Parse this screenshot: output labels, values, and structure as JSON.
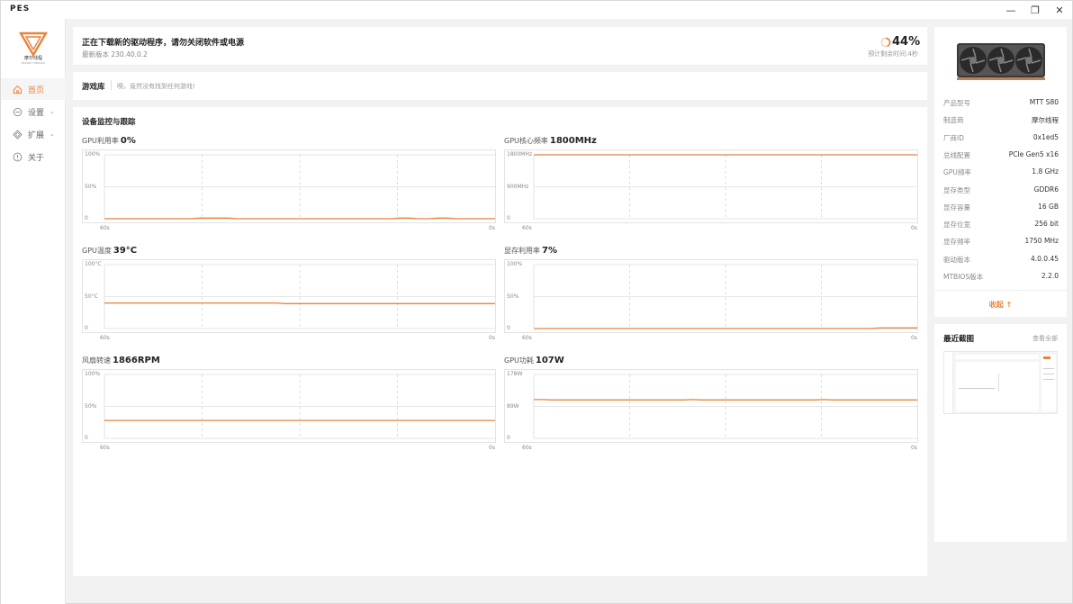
{
  "app": {
    "title": "PES"
  },
  "window_controls": {
    "minimize": "—",
    "restore": "❐",
    "close": "✕"
  },
  "brand": {
    "name": "摩尔线程",
    "sub": "MOORE THREADS"
  },
  "sidebar": {
    "items": [
      {
        "label": "首页",
        "icon": "home-icon",
        "active": true
      },
      {
        "label": "设置",
        "icon": "settings-icon",
        "chevron": "⌄"
      },
      {
        "label": "扩展",
        "icon": "extension-icon",
        "chevron": "⌄"
      },
      {
        "label": "关于",
        "icon": "info-icon"
      }
    ]
  },
  "download": {
    "title": "正在下载新的驱动程序，请勿关闭软件或电源",
    "version": "最新版本 230.40.0.2",
    "percent": "44%",
    "progress": 0.44,
    "remaining": "预计剩余时间:4秒",
    "accent": "#e8833a"
  },
  "library": {
    "title": "游戏库",
    "empty": "噢，竟然没有找到任何游戏!"
  },
  "monitor": {
    "title": "设备监控与跟踪",
    "charts": [
      {
        "label": "GPU利用率",
        "value": "0%",
        "yticks": [
          "100%",
          "50%",
          "0"
        ],
        "ymax": 100,
        "x_start": "60s",
        "x_end": "0s",
        "series": [
          0,
          0,
          0,
          0,
          0,
          0,
          0,
          0,
          0,
          0,
          1,
          1,
          1,
          1,
          0,
          0,
          0,
          0,
          0,
          0,
          0,
          0,
          0,
          0,
          0,
          0,
          0,
          0,
          0,
          0,
          0,
          1,
          1,
          0,
          0,
          1,
          1,
          0,
          0,
          0,
          0,
          0
        ]
      },
      {
        "label": "GPU核心频率",
        "value": "1800MHz",
        "yticks": [
          "1800MHz",
          "900MHz",
          "0"
        ],
        "ymax": 1800,
        "x_start": "60s",
        "x_end": "0s",
        "series": [
          1800,
          1800,
          1800,
          1800,
          1800,
          1800,
          1800,
          1800,
          1800,
          1800,
          1800,
          1800,
          1800,
          1800,
          1800,
          1800,
          1800,
          1800,
          1800,
          1800,
          1800,
          1800
        ]
      },
      {
        "label": "GPU温度",
        "value": "39°C",
        "yticks": [
          "100°C",
          "50°C",
          "0"
        ],
        "ymax": 100,
        "x_start": "60s",
        "x_end": "0s",
        "series": [
          40,
          40,
          40,
          40,
          40,
          40,
          40,
          40,
          40,
          40,
          40,
          40,
          40,
          40,
          40,
          40,
          40,
          40,
          40,
          39,
          39,
          39,
          39,
          39,
          39,
          39,
          39,
          39,
          39,
          39,
          39,
          39,
          39,
          39,
          39,
          39,
          39,
          39,
          39,
          39,
          39,
          39
        ]
      },
      {
        "label": "显存利用率",
        "value": "7%",
        "yticks": [
          "100%",
          "50%",
          "0"
        ],
        "ymax": 100,
        "x_start": "60s",
        "x_end": "0s",
        "series": [
          0,
          0,
          0,
          0,
          0,
          0,
          0,
          0,
          0,
          0,
          0,
          0,
          0,
          0,
          0,
          0,
          0,
          0,
          0,
          0,
          0,
          0,
          0,
          0,
          0,
          0,
          0,
          0,
          0,
          0,
          0,
          0,
          0,
          0,
          0,
          0,
          0,
          1,
          1,
          1,
          1,
          1
        ]
      },
      {
        "label": "风扇转速",
        "value": "1866RPM",
        "yticks": [
          "100%",
          "50%",
          "0"
        ],
        "ymax": 100,
        "x_start": "60s",
        "x_end": "0s",
        "series": [
          28,
          28,
          28,
          28,
          28,
          28,
          28,
          28,
          28,
          28,
          28,
          28,
          28,
          28,
          28,
          28,
          28,
          28,
          28,
          28,
          28,
          28,
          28,
          28,
          28,
          28,
          28,
          28,
          28,
          28,
          28,
          28,
          28,
          28,
          28,
          28,
          28,
          28,
          28,
          28,
          28,
          28
        ]
      },
      {
        "label": "GPU功耗",
        "value": "107W",
        "yticks": [
          "178W",
          "89W",
          "0"
        ],
        "ymax": 178,
        "x_start": "60s",
        "x_end": "0s",
        "series": [
          108,
          108,
          107,
          107,
          107,
          107,
          107,
          107,
          107,
          107,
          107,
          107,
          107,
          107,
          107,
          107,
          107,
          108,
          107,
          107,
          107,
          107,
          107,
          107,
          107,
          107,
          107,
          107,
          107,
          107,
          107,
          108,
          107,
          107,
          107,
          107,
          107,
          107,
          107,
          107,
          107,
          107
        ]
      }
    ]
  },
  "device": {
    "rows": [
      {
        "k": "产品型号",
        "v": "MTT S80"
      },
      {
        "k": "制造商",
        "v": "摩尔线程"
      },
      {
        "k": "厂商ID",
        "v": "0x1ed5"
      },
      {
        "k": "总线配置",
        "v": "PCIe Gen5 x16"
      },
      {
        "k": "GPU频率",
        "v": "1.8 GHz"
      },
      {
        "k": "显存类型",
        "v": "GDDR6"
      },
      {
        "k": "显存容量",
        "v": "16 GB"
      },
      {
        "k": "显存位宽",
        "v": "256 bit"
      },
      {
        "k": "显存频率",
        "v": "1750 MHz"
      },
      {
        "k": "驱动版本",
        "v": "4.0.0.45"
      },
      {
        "k": "MTBIOS版本",
        "v": "2.2.0"
      }
    ],
    "collapse": "收起 ↑"
  },
  "screenshots": {
    "title": "最近截图",
    "view_all": "查看全部"
  }
}
